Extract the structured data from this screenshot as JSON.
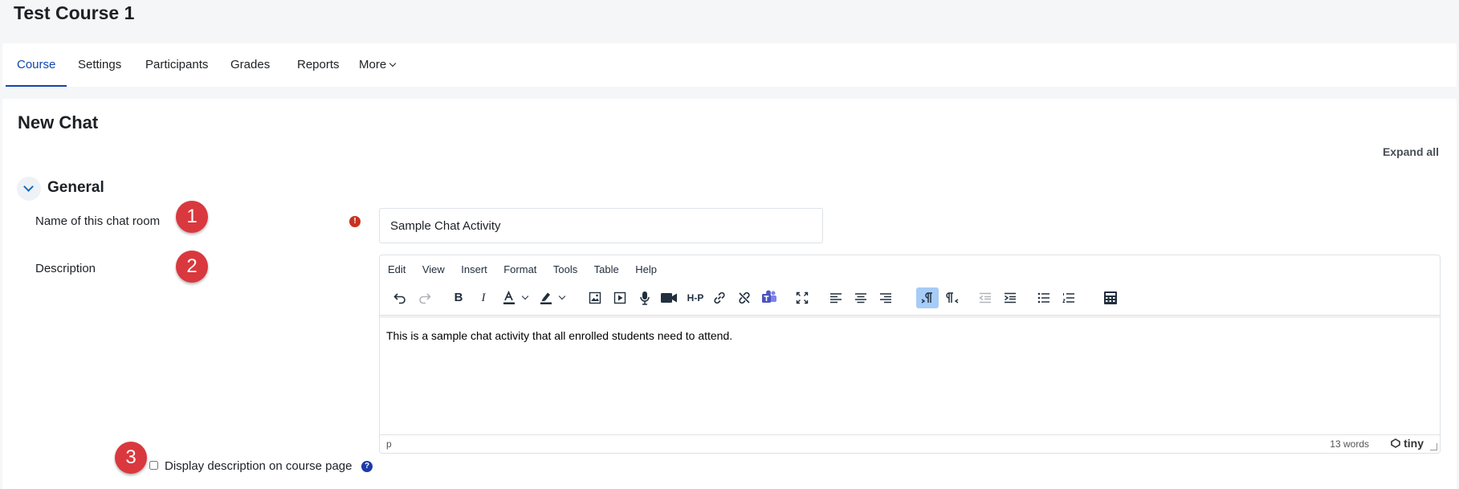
{
  "course": {
    "title": "Test Course 1"
  },
  "nav": {
    "tabs": [
      {
        "label": "Course",
        "active": true
      },
      {
        "label": "Settings"
      },
      {
        "label": "Participants"
      },
      {
        "label": "Grades"
      },
      {
        "label": "Reports"
      },
      {
        "label": "More"
      }
    ]
  },
  "page": {
    "title": "New Chat",
    "expand_all": "Expand all"
  },
  "section": {
    "title": "General"
  },
  "form": {
    "name_label": "Name of this chat room",
    "name_value": "Sample Chat Activity",
    "required_icon": "exclamation-circle-icon",
    "description_label": "Description",
    "checkbox_label": "Display description on course page",
    "checkbox_checked": false,
    "help_icon": "question-circle-icon"
  },
  "callouts": [
    "1",
    "2",
    "3"
  ],
  "editor": {
    "menu": [
      "Edit",
      "View",
      "Insert",
      "Format",
      "Tools",
      "Table",
      "Help"
    ],
    "toolbar_icons": [
      "undo-icon",
      "redo-icon",
      "bold-icon",
      "italic-icon",
      "text-color-icon",
      "highlight-icon",
      "image-icon",
      "media-icon",
      "microphone-icon",
      "video-camera-icon",
      "h5p-icon",
      "link-icon",
      "unlink-icon",
      "teams-icon",
      "fullscreen-icon",
      "align-left-icon",
      "align-center-icon",
      "align-right-icon",
      "ltr-icon",
      "rtl-icon",
      "outdent-icon",
      "indent-icon",
      "bullet-list-icon",
      "numbered-list-icon",
      "calculator-icon"
    ],
    "bold_glyph": "B",
    "italic_glyph": "I",
    "h5p_glyph": "H-P",
    "content": "This is a sample chat activity that all enrolled students need to attend.",
    "path": "p",
    "word_count": "13 words",
    "brand": "tiny"
  },
  "colors": {
    "accent": "#0f47ad",
    "callout": "#d9383e",
    "required": "#ca3120",
    "help": "#1c3aa8",
    "active_button": "#a6ccf7"
  }
}
